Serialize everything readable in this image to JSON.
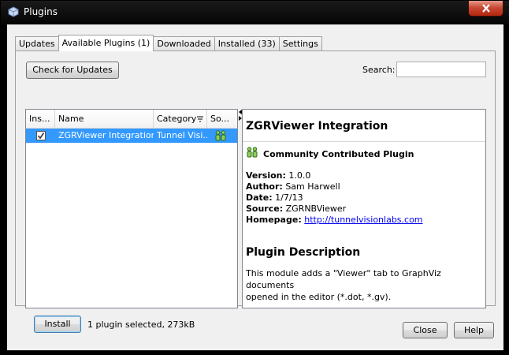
{
  "window": {
    "title": "Plugins"
  },
  "tabs": [
    {
      "label": "Updates",
      "active": false
    },
    {
      "label": "Available Plugins (1)",
      "active": true
    },
    {
      "label": "Downloaded",
      "active": false
    },
    {
      "label": "Installed (33)",
      "active": false
    },
    {
      "label": "Settings",
      "active": false
    }
  ],
  "toolbar": {
    "check_updates_label": "Check for Updates",
    "search_label": "Search:",
    "search_value": ""
  },
  "table": {
    "headers": {
      "install": "Ins...",
      "name": "Name",
      "category": "Category",
      "source": "So..."
    },
    "rows": [
      {
        "checked": true,
        "name": "ZGRViewer Integration",
        "category": "Tunnel Visi...",
        "source_icon": "community-icon"
      }
    ]
  },
  "detail": {
    "title": "ZGRViewer Integration",
    "badge": "Community Contributed Plugin",
    "version_label": "Version:",
    "version": "1.0.0",
    "author_label": "Author:",
    "author": "Sam Harwell",
    "date_label": "Date:",
    "date": "1/7/13",
    "source_label": "Source:",
    "source": "ZGRNBViewer",
    "homepage_label": "Homepage:",
    "homepage": "http://tunnelvisionlabs.com",
    "desc_title": "Plugin Description",
    "desc_line1": "This module adds a \"Viewer\" tab to GraphViz documents",
    "desc_line2": "opened in the editor (*.dot, *.gv)."
  },
  "footer": {
    "install_label": "Install",
    "status": "1 plugin selected, 273kB"
  },
  "dialog": {
    "close_label": "Close",
    "help_label": "Help"
  },
  "colors": {
    "selection": "#3399ff",
    "link": "#0000ee"
  }
}
